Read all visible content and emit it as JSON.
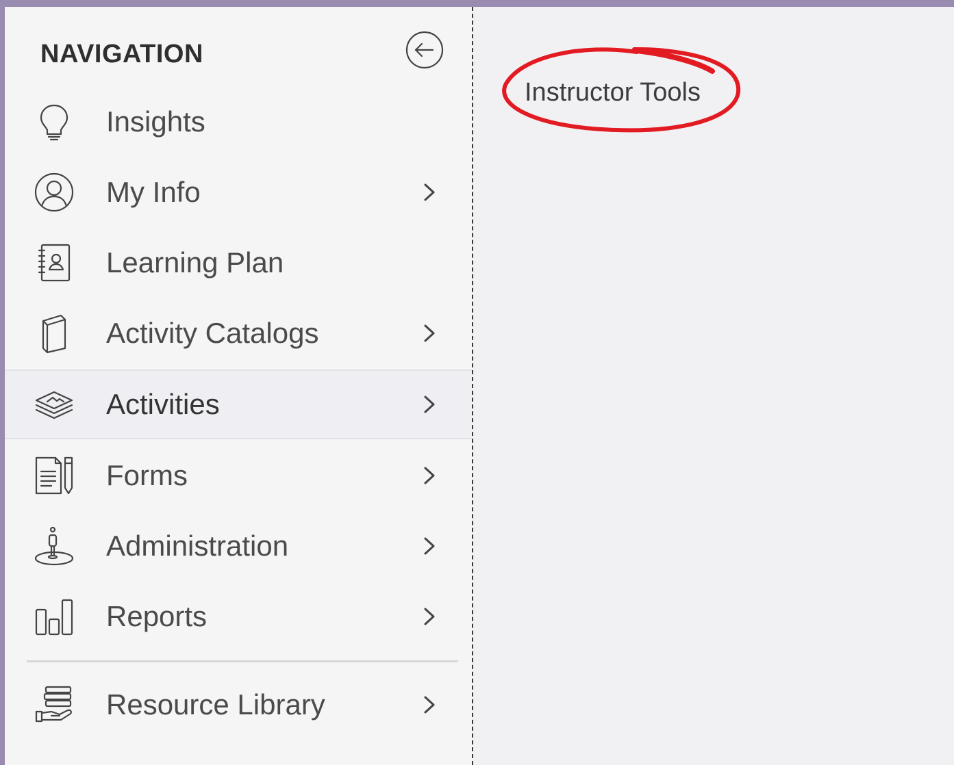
{
  "sidebar": {
    "header": "NAVIGATION",
    "collapse_icon": "arrow-left-circle-icon",
    "items": [
      {
        "label": "Insights",
        "icon": "lightbulb-icon",
        "has_chevron": false
      },
      {
        "label": "My Info",
        "icon": "user-circle-icon",
        "has_chevron": true
      },
      {
        "label": "Learning Plan",
        "icon": "contact-notebook-icon",
        "has_chevron": false
      },
      {
        "label": "Activity Catalogs",
        "icon": "book-icon",
        "has_chevron": true
      },
      {
        "label": "Activities",
        "icon": "layers-icon",
        "has_chevron": true,
        "active": true
      },
      {
        "label": "Forms",
        "icon": "form-pencil-icon",
        "has_chevron": true
      },
      {
        "label": "Administration",
        "icon": "admin-person-icon",
        "has_chevron": true
      },
      {
        "label": "Reports",
        "icon": "bar-chart-icon",
        "has_chevron": true
      },
      {
        "label": "Resource Library",
        "icon": "books-hand-icon",
        "has_chevron": true
      }
    ]
  },
  "main": {
    "link_label": "Instructor Tools",
    "annotation_color": "#e21b22"
  },
  "colors": {
    "sidebar_bg": "#f5f5f5",
    "main_bg": "#f1f1f4",
    "text": "#4a4a4a",
    "outer_frame": "#9a8bb0"
  }
}
